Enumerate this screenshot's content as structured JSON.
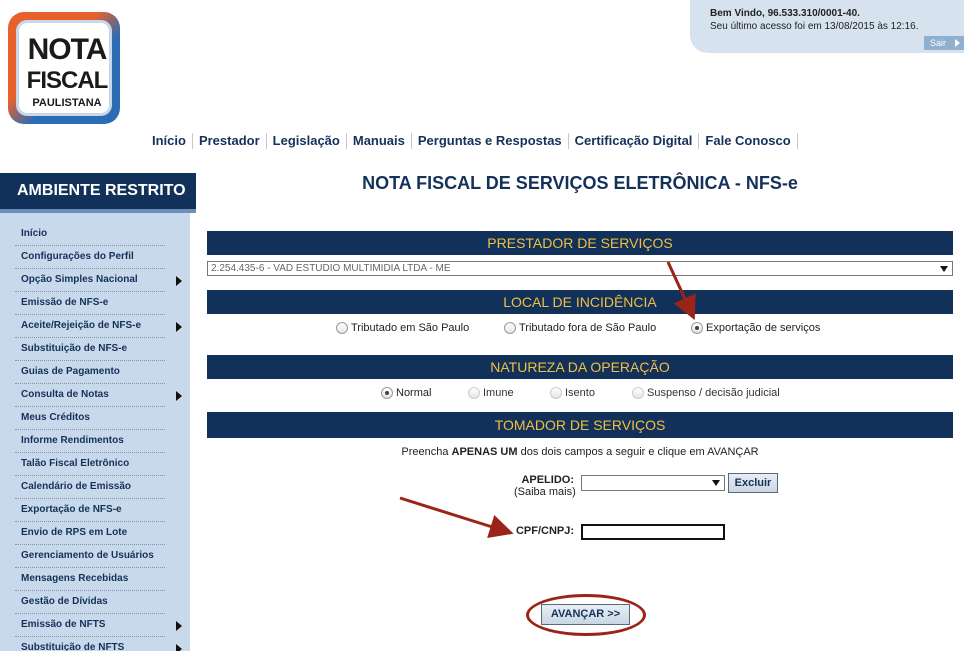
{
  "logo": {
    "line1": "NOTA",
    "line2": "FISCAL",
    "line3": "PAULISTANA"
  },
  "welcome": {
    "greeting": "Bem Vindo, 96.533.310/0001-40.",
    "last_access": "Seu último acesso foi em 13/08/2015 às 12:16.",
    "logout_label": "Sair"
  },
  "topnav": [
    "Início",
    "Prestador",
    "Legislação",
    "Manuais",
    "Perguntas e Respostas",
    "Certificação Digital",
    "Fale Conosco"
  ],
  "sidebar": {
    "title": "AMBIENTE RESTRITO",
    "items": [
      {
        "label": "Início",
        "has_submenu": false
      },
      {
        "label": "Configurações do Perfil",
        "has_submenu": false
      },
      {
        "label": "Opção Simples Nacional",
        "has_submenu": true
      },
      {
        "label": "Emissão de NFS-e",
        "has_submenu": false
      },
      {
        "label": "Aceite/Rejeição de NFS-e",
        "has_submenu": true
      },
      {
        "label": "Substituição de NFS-e",
        "has_submenu": false
      },
      {
        "label": "Guias de Pagamento",
        "has_submenu": false
      },
      {
        "label": "Consulta de Notas",
        "has_submenu": true
      },
      {
        "label": "Meus Créditos",
        "has_submenu": false
      },
      {
        "label": "Informe Rendimentos",
        "has_submenu": false
      },
      {
        "label": "Talão Fiscal Eletrônico",
        "has_submenu": false
      },
      {
        "label": "Calendário de Emissão",
        "has_submenu": false
      },
      {
        "label": "Exportação de NFS-e",
        "has_submenu": false
      },
      {
        "label": "Envio de RPS em Lote",
        "has_submenu": false
      },
      {
        "label": "Gerenciamento de Usuários",
        "has_submenu": false
      },
      {
        "label": "Mensagens Recebidas",
        "has_submenu": false
      },
      {
        "label": "Gestão de Dívidas",
        "has_submenu": false
      },
      {
        "label": "Emissão de NFTS",
        "has_submenu": true
      },
      {
        "label": "Substituição de NFTS",
        "has_submenu": true
      }
    ]
  },
  "main": {
    "page_title": "NOTA FISCAL DE SERVIÇOS ELETRÔNICA - NFS-e",
    "prestador": {
      "header": "PRESTADOR DE SERVIÇOS",
      "selected": "2.254.435-6 - VAD ESTUDIO MULTIMIDIA LTDA - ME"
    },
    "local": {
      "header": "LOCAL DE INCIDÊNCIA",
      "options": [
        "Tributado em São Paulo",
        "Tributado fora de São Paulo",
        "Exportação de serviços"
      ],
      "selected_index": 2
    },
    "natureza": {
      "header": "NATUREZA DA OPERAÇÃO",
      "options": [
        "Normal",
        "Imune",
        "Isento",
        "Suspenso / decisão judicial"
      ],
      "selected_index": 0
    },
    "tomador": {
      "header": "TOMADOR DE SERVIÇOS",
      "hint_pre": "Preencha ",
      "hint_bold": "APENAS UM",
      "hint_post": " dos dois campos a seguir e clique em AVANÇAR",
      "apelido_label": "APELIDO:",
      "apelido_sub": "(Saiba mais)",
      "apelido_value": "",
      "excluir_label": "Excluir",
      "cpf_label": "CPF/CNPJ:",
      "cpf_value": ""
    },
    "avancar_label": "AVANÇAR >>"
  },
  "colors": {
    "navy": "#11305a",
    "gold": "#f0c040",
    "sidebar_bg": "#c7d9ea",
    "annotation": "#9b2418"
  }
}
